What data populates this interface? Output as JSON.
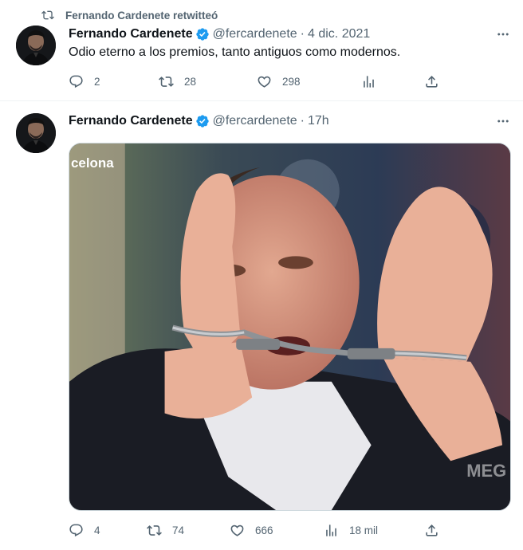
{
  "retweet_banner": {
    "text": "Fernando Cardenete retwitteó",
    "icon": "retweet-icon"
  },
  "tweets": [
    {
      "author_name": "Fernando Cardenete",
      "handle": "@fercardenete",
      "separator": "·",
      "time": "4 dic. 2021",
      "text": "Odio eterno a los premios, tanto antiguos como modernos.",
      "replies": "2",
      "retweets": "28",
      "likes": "298",
      "views": ""
    },
    {
      "author_name": "Fernando Cardenete",
      "handle": "@fercardenete",
      "separator": "·",
      "time": "17h",
      "image_overlay_text": "celona",
      "replies": "4",
      "retweets": "74",
      "likes": "666",
      "views": "18 mil"
    }
  ],
  "colors": {
    "verified": "#1d9bf0",
    "secondary_text": "#536471",
    "primary_text": "#0f1419",
    "divider": "#eff3f4"
  }
}
